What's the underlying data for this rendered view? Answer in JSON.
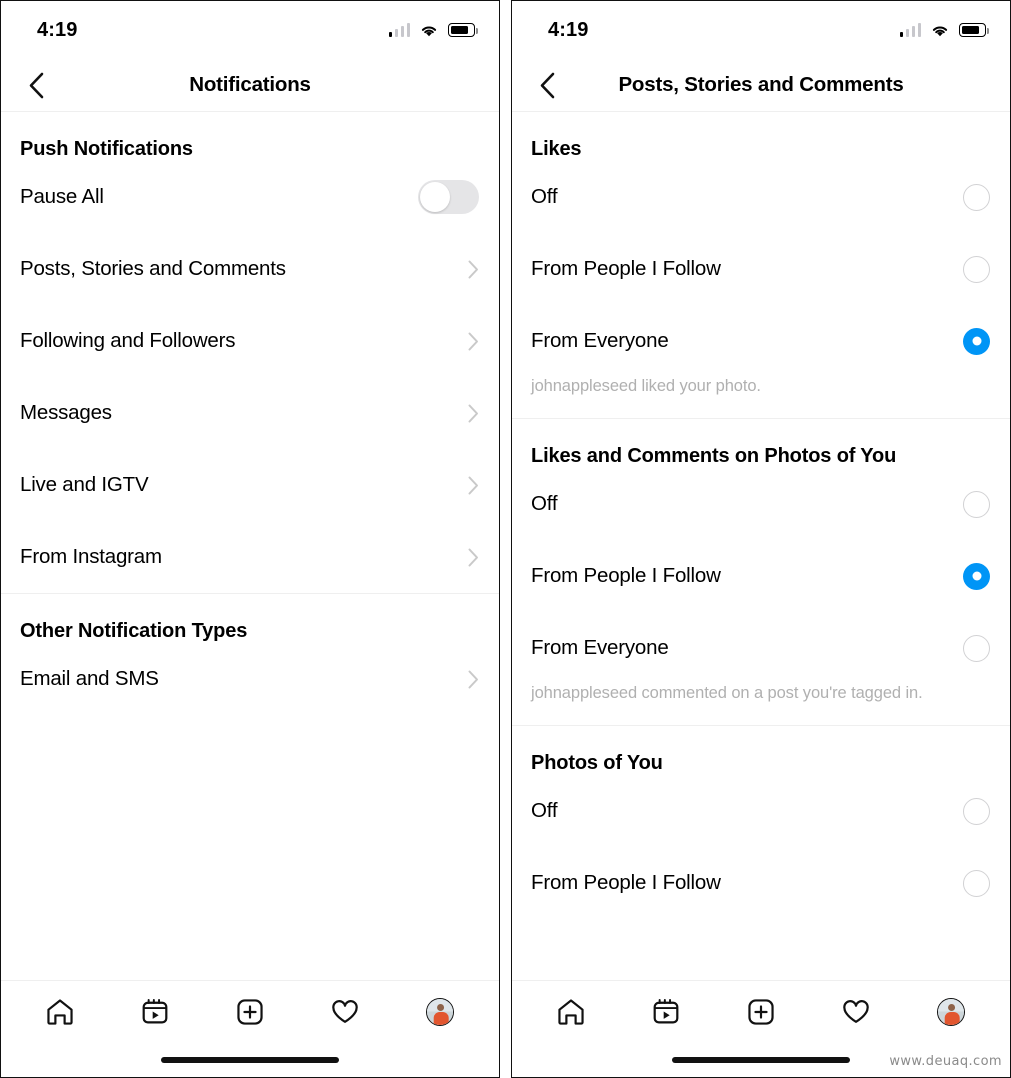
{
  "status_bar": {
    "time": "4:19",
    "signal_icon": "cellular-signal-icon",
    "wifi_icon": "wifi-icon",
    "battery_icon": "battery-icon"
  },
  "colors": {
    "accent_blue": "#0095f6",
    "toggle_off_track": "#e5e5e7",
    "radio_border": "#d2d2d4",
    "divider": "#efefef",
    "hint_text": "#b0b0b0"
  },
  "left_panel": {
    "title": "Notifications",
    "back_icon": "back-chevron-icon",
    "sections": [
      {
        "header": "Push Notifications",
        "rows": [
          {
            "label": "Pause All",
            "control": "toggle",
            "value": "off"
          },
          {
            "label": "Posts, Stories and Comments",
            "control": "chevron"
          },
          {
            "label": "Following and Followers",
            "control": "chevron"
          },
          {
            "label": "Messages",
            "control": "chevron"
          },
          {
            "label": "Live and IGTV",
            "control": "chevron"
          },
          {
            "label": "From Instagram",
            "control": "chevron"
          }
        ]
      },
      {
        "header": "Other Notification Types",
        "rows": [
          {
            "label": "Email and SMS",
            "control": "chevron"
          }
        ]
      }
    ]
  },
  "right_panel": {
    "title": "Posts, Stories and Comments",
    "back_icon": "back-chevron-icon",
    "sections": [
      {
        "header": "Likes",
        "options": [
          {
            "label": "Off",
            "selected": false
          },
          {
            "label": "From People I Follow",
            "selected": false
          },
          {
            "label": "From Everyone",
            "selected": true
          }
        ],
        "hint": "johnappleseed liked your photo."
      },
      {
        "header": "Likes and Comments on Photos of You",
        "options": [
          {
            "label": "Off",
            "selected": false
          },
          {
            "label": "From People I Follow",
            "selected": true
          },
          {
            "label": "From Everyone",
            "selected": false
          }
        ],
        "hint": "johnappleseed commented on a post you're tagged in."
      },
      {
        "header": "Photos of You",
        "options": [
          {
            "label": "Off",
            "selected": false
          },
          {
            "label": "From People I Follow",
            "selected": false
          }
        ],
        "hint": ""
      }
    ]
  },
  "tab_bar": {
    "tabs": [
      {
        "name": "home-icon",
        "label": "Home"
      },
      {
        "name": "reels-icon",
        "label": "Reels"
      },
      {
        "name": "add-post-icon",
        "label": "Create"
      },
      {
        "name": "heart-icon",
        "label": "Activity"
      },
      {
        "name": "profile-avatar",
        "label": "Profile"
      }
    ]
  },
  "watermark": "www.deuaq.com"
}
